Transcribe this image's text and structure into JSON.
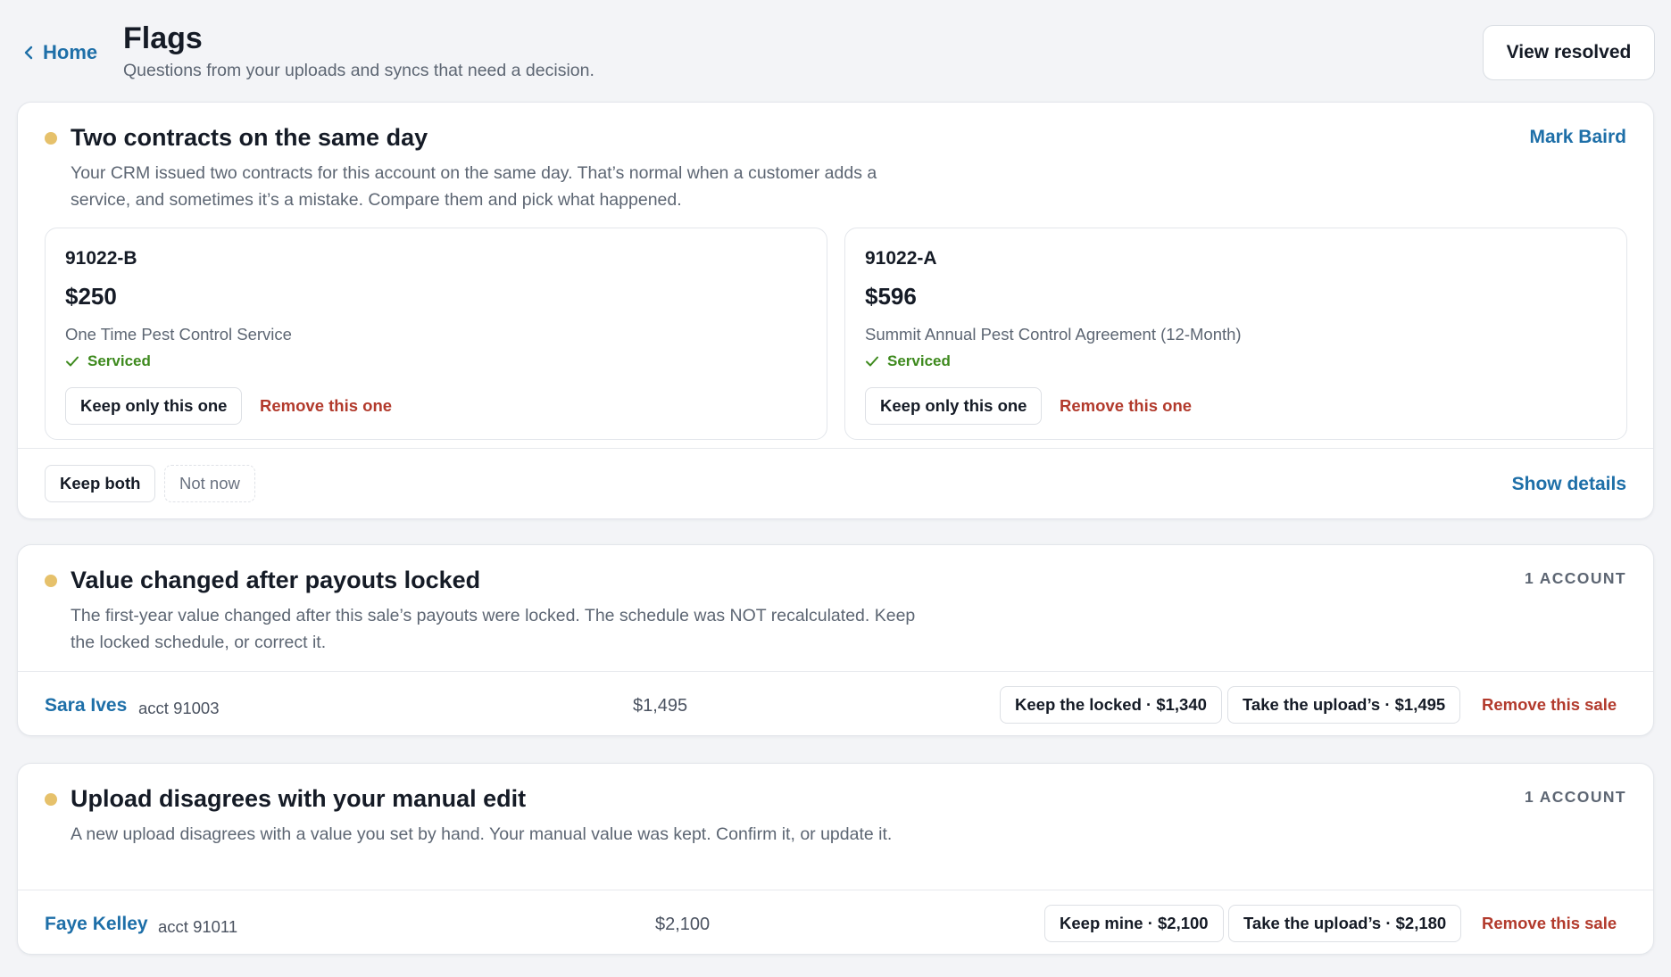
{
  "header": {
    "back_label": "Home",
    "title": "Flags",
    "subtitle": "Questions from your uploads and syncs that need a decision.",
    "view_resolved_label": "View resolved"
  },
  "colors": {
    "accent": "#1e6fa8",
    "danger": "#b23a2c",
    "success": "#3e8a1e",
    "flag_dot": "#e6c16b"
  },
  "flags": [
    {
      "title": "Two contracts on the same day",
      "owner": "Mark Baird",
      "description": "Your CRM issued two contracts for this account on the same day. That’s normal when a customer adds a service, and sometimes it’s a mistake. Compare them and pick what happened.",
      "contracts": [
        {
          "id": "91022-B",
          "amount": "$250",
          "description": "One Time Pest Control Service",
          "status": "Serviced",
          "keep_label": "Keep only this one",
          "remove_label": "Remove this one"
        },
        {
          "id": "91022-A",
          "amount": "$596",
          "description": "Summit Annual Pest Control Agreement (12-Month)",
          "status": "Serviced",
          "keep_label": "Keep only this one",
          "remove_label": "Remove this one"
        }
      ],
      "keep_both_label": "Keep both",
      "not_now_label": "Not now",
      "show_details_label": "Show details"
    },
    {
      "title": "Value changed after payouts locked",
      "count_label": "1 ACCOUNT",
      "description": "The first-year value changed after this sale’s payouts were locked. The schedule was NOT recalculated. Keep the locked schedule, or correct it.",
      "row": {
        "name": "Sara Ives",
        "acct": "acct 91003",
        "amount": "$1,495",
        "option_a": "Keep the locked · $1,340",
        "option_b": "Take the upload’s · $1,495",
        "remove_label": "Remove this sale"
      }
    },
    {
      "title": "Upload disagrees with your manual edit",
      "count_label": "1 ACCOUNT",
      "description": "A new upload disagrees with a value you set by hand. Your manual value was kept. Confirm it, or update it.",
      "row": {
        "name": "Faye Kelley",
        "acct": "acct 91011",
        "amount": "$2,100",
        "option_a": "Keep mine · $2,100",
        "option_b": "Take the upload’s · $2,180",
        "remove_label": "Remove this sale"
      }
    }
  ]
}
